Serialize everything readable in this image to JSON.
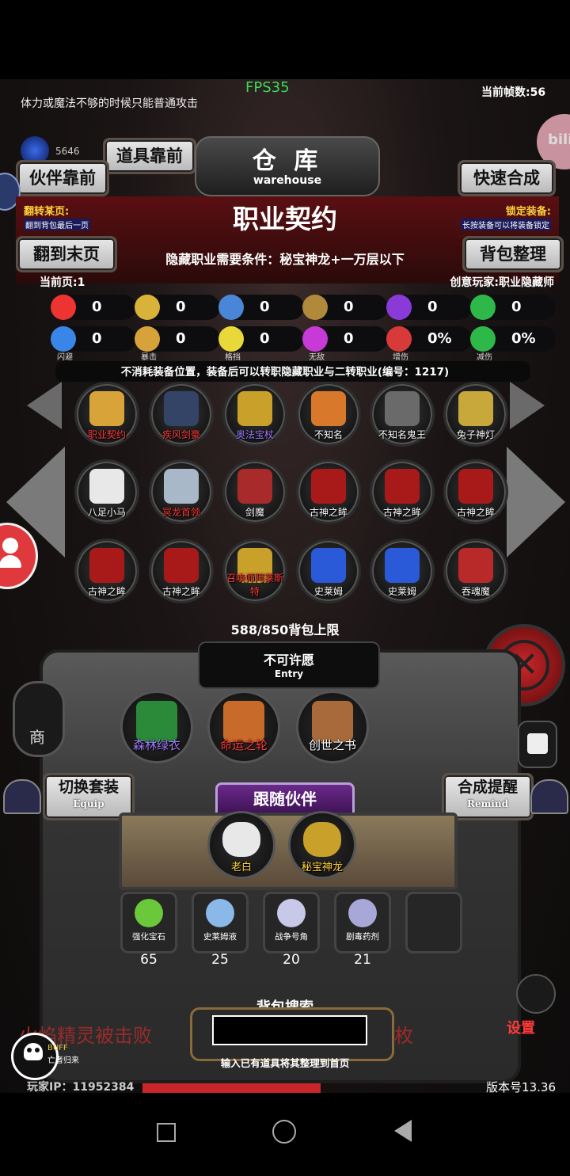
{
  "status": {
    "fps": "FPS35",
    "frame_rate": "当前帧数:56",
    "tip": "体力或魔法不够的时候只能普通攻击"
  },
  "header": {
    "gem_count": "5646",
    "btn_items_front": "道具靠前",
    "btn_partner_front": "伙伴靠前",
    "warehouse_cn": "仓 库",
    "warehouse_en": "warehouse",
    "btn_quick_merge": "快速合成",
    "turn_page_label": "翻转某页:",
    "turn_page_hint": "翻到背包最后一页",
    "title": "职业契约",
    "lock_label": "锁定装备:",
    "lock_hint": "长按装备可以将装备锁定",
    "btn_last_page": "翻到末页",
    "hidden_req": "隐藏职业需要条件：秘宝神龙+一万层以下",
    "btn_sort": "背包整理",
    "current_page": "当前页:1",
    "creator": "创意玩家:职业隐藏师"
  },
  "stats_row1": [
    {
      "icon": "heart-icon",
      "value": "0",
      "color": "#e33"
    },
    {
      "icon": "strength-icon",
      "value": "0",
      "color": "#d9b23a"
    },
    {
      "icon": "boot-icon",
      "value": "0",
      "color": "#4a86d8"
    },
    {
      "icon": "sword-icon",
      "value": "0",
      "color": "#b08a3a"
    },
    {
      "icon": "lightning-icon",
      "value": "0",
      "color": "#8a3ad8"
    },
    {
      "icon": "clover-icon",
      "value": "0",
      "color": "#2fb84a"
    }
  ],
  "stats_row2": [
    {
      "icon": "dodge-icon",
      "value": "0",
      "sub": "闪避",
      "color": "#3a86e8"
    },
    {
      "icon": "crit-icon",
      "value": "0",
      "sub": "暴击",
      "color": "#d8a23a"
    },
    {
      "icon": "block-icon",
      "value": "0",
      "sub": "格挡",
      "color": "#e8d83a"
    },
    {
      "icon": "invincible-icon",
      "value": "0",
      "sub": "无敌",
      "color": "#c83ad8"
    },
    {
      "icon": "dmg-up-icon",
      "value": "0%",
      "sub": "增伤",
      "color": "#d83a3a"
    },
    {
      "icon": "dmg-down-icon",
      "value": "0%",
      "sub": "减伤",
      "color": "#2fb84a"
    }
  ],
  "item_desc": "不消耗装备位置，装备后可以转职隐藏职业与二转职业(编号：1217)",
  "grid": [
    {
      "label": "职业契约",
      "style": "red",
      "color": "#d8a43a"
    },
    {
      "label": "疾风剑豪",
      "style": "red",
      "color": "#334466"
    },
    {
      "label": "奥法宝杖",
      "style": "purple",
      "color": "#c8a02a"
    },
    {
      "label": "不知名",
      "style": "white",
      "color": "#d8782a"
    },
    {
      "label": "不知名鬼王",
      "style": "white",
      "color": "#6a6a6a"
    },
    {
      "label": "兔子神灯",
      "style": "white",
      "color": "#c8a83a"
    },
    {
      "label": "八足小马",
      "style": "white",
      "color": "#e8e8e8"
    },
    {
      "label": "冥龙首领",
      "style": "red",
      "color": "#a8b8c8"
    },
    {
      "label": "剑魔",
      "style": "white",
      "color": "#a82a2a"
    },
    {
      "label": "古神之眸",
      "style": "white",
      "color": "#a81a1a"
    },
    {
      "label": "古神之眸",
      "style": "white",
      "color": "#a81a1a"
    },
    {
      "label": "古神之眸",
      "style": "white",
      "color": "#a81a1a"
    },
    {
      "label": "古神之眸",
      "style": "white",
      "color": "#a81a1a"
    },
    {
      "label": "古神之眸",
      "style": "white",
      "color": "#a81a1a"
    },
    {
      "label": "召唤师阿莱斯特",
      "style": "red",
      "color": "#c8a02a"
    },
    {
      "label": "史莱姆",
      "style": "white",
      "color": "#2a5ad8"
    },
    {
      "label": "史莱姆",
      "style": "white",
      "color": "#2a5ad8"
    },
    {
      "label": "吞魂魔",
      "style": "white",
      "color": "#b82a2a"
    }
  ],
  "bag_capacity": "588/850背包上限",
  "entry": {
    "title": "不可许愿",
    "sub": "Entry"
  },
  "equipped": [
    {
      "label": "森林绿衣",
      "style": "purple",
      "color": "#2a8a3a"
    },
    {
      "label": "命运之轮",
      "style": "red",
      "color": "#c86a2a"
    },
    {
      "label": "创世之书",
      "style": "white",
      "color": "#a86a3a"
    }
  ],
  "btn_switch_set": "切换套装",
  "btn_switch_set_en": "Equip",
  "btn_merge_remind": "合成提醒",
  "btn_merge_remind_en": "Remind",
  "follow_partner": "跟随伙伴",
  "partners": [
    {
      "label": "老白",
      "color": "#e8e8e8"
    },
    {
      "label": "秘宝神龙",
      "color": "#c8a02a"
    }
  ],
  "consumables": [
    {
      "label": "强化宝石",
      "count": "65",
      "color": "#6ac83a"
    },
    {
      "label": "史莱姆液",
      "count": "25",
      "color": "#8ab8e8"
    },
    {
      "label": "战争号角",
      "count": "20",
      "color": "#c8c8e8"
    },
    {
      "label": "剧毒药剂",
      "count": "21",
      "color": "#a8a8d8"
    }
  ],
  "search": {
    "title": "背包搜索",
    "hint": "输入已有道具将其整理到首页",
    "placeholder": ""
  },
  "bottom": {
    "bg_text_left": "火焰精灵被击败",
    "bg_text_right": "枚",
    "buff": "BUFF",
    "buff_sub": "亡者归来",
    "player_ip": "玩家IP：11952384",
    "version": "版本号13.36",
    "settings": "设置",
    "shop": "商"
  }
}
